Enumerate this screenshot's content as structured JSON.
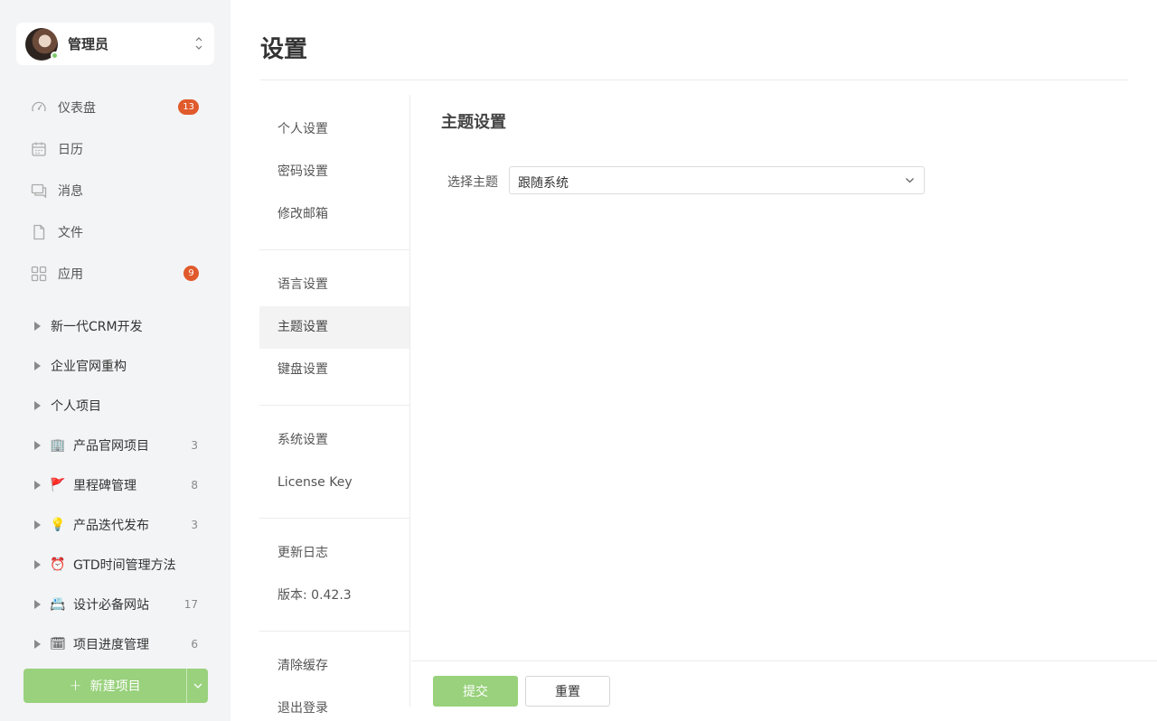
{
  "user": {
    "name": "管理员",
    "status_color": "#7fc96b"
  },
  "nav": [
    {
      "label": "仪表盘",
      "icon": "dashboard-icon",
      "badge": "13"
    },
    {
      "label": "日历",
      "icon": "calendar-icon",
      "badge": null
    },
    {
      "label": "消息",
      "icon": "message-icon",
      "badge": null
    },
    {
      "label": "文件",
      "icon": "file-icon",
      "badge": null
    },
    {
      "label": "应用",
      "icon": "apps-icon",
      "badge": "9"
    }
  ],
  "projects": [
    {
      "emoji": "",
      "label": "新一代CRM开发",
      "count": ""
    },
    {
      "emoji": "",
      "label": "企业官网重构",
      "count": ""
    },
    {
      "emoji": "",
      "label": "个人项目",
      "count": ""
    },
    {
      "emoji": "🏢",
      "label": "产品官网项目",
      "count": "3"
    },
    {
      "emoji": "🚩",
      "label": "里程碑管理",
      "count": "8"
    },
    {
      "emoji": "💡",
      "label": "产品迭代发布",
      "count": "3"
    },
    {
      "emoji": "⏰",
      "label": "GTD时间管理方法",
      "count": ""
    },
    {
      "emoji": "📇",
      "label": "设计必备网站",
      "count": "17"
    },
    {
      "emoji": "🗓",
      "label": "项目进度管理",
      "count": "6"
    }
  ],
  "new_project_label": "新建项目",
  "page_title": "设置",
  "settings_nav": [
    [
      "个人设置",
      "密码设置",
      "修改邮箱"
    ],
    [
      "语言设置",
      "主题设置",
      "键盘设置"
    ],
    [
      "系统设置",
      "License Key"
    ],
    [
      "更新日志",
      "版本: 0.42.3"
    ],
    [
      "清除缓存",
      "退出登录"
    ]
  ],
  "active_setting": "主题设置",
  "section_title": "主题设置",
  "theme_field": {
    "label": "选择主题",
    "value": "跟随系统"
  },
  "buttons": {
    "submit": "提交",
    "reset": "重置"
  },
  "colors": {
    "accent": "#99d17c",
    "badge": "#e05a2b"
  }
}
